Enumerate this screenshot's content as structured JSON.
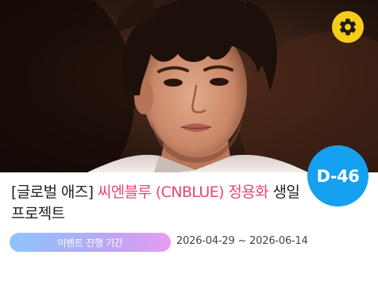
{
  "card": {
    "title_prefix": "[글로벌 애즈] ",
    "title_artist": "씨엔블루 (CNBLUE) 정용화",
    "title_suffix": " 생일 프로젝트",
    "dday": "D-46",
    "period_label": "이벤트 진행 기간",
    "period_dates": "2026-04-29 ~ 2026-06-14"
  },
  "icons": {
    "settings": "gear-icon"
  },
  "colors": {
    "artist_text": "#e6457a",
    "dday_badge": "#16a0f0",
    "settings_badge": "#f6cd16",
    "pill_gradient_start": "#8fc6f8",
    "pill_gradient_end": "#e69cf4"
  }
}
